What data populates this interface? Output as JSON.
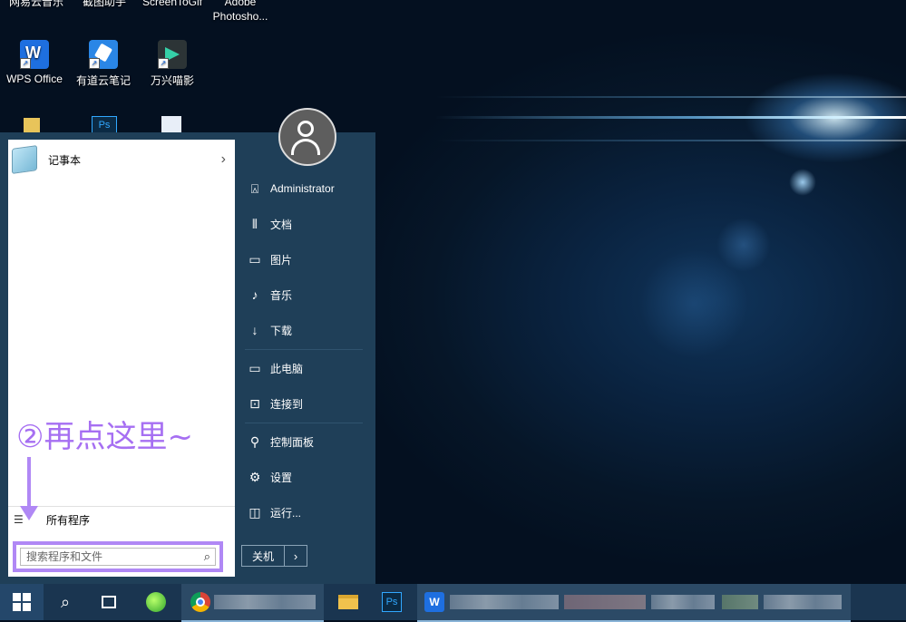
{
  "desktop": {
    "top_labels": [
      "网易云音乐",
      "截图助手",
      "ScreenToGif",
      "Adobe Photosho..."
    ],
    "icons": [
      {
        "label": "WPS Office",
        "icon": "wps-office-icon",
        "color": "#1e6fe0"
      },
      {
        "label": "有道云笔记",
        "icon": "youdao-note-icon",
        "color": "#2a86e6"
      },
      {
        "label": "万兴喵影",
        "icon": "filmora-icon",
        "color": "#2c3436"
      }
    ]
  },
  "start_menu": {
    "pinned": [
      {
        "label": "记事本",
        "icon": "notepad-icon"
      }
    ],
    "all_programs_label": "所有程序",
    "search_placeholder": "搜索程序和文件",
    "annotation": "②再点这里~",
    "right_items": [
      {
        "label": "Administrator",
        "icon": "user-folder-icon"
      },
      {
        "label": "文档",
        "icon": "documents-icon"
      },
      {
        "label": "图片",
        "icon": "pictures-icon"
      },
      {
        "label": "音乐",
        "icon": "music-icon"
      },
      {
        "label": "下载",
        "icon": "download-icon"
      },
      {
        "label": "此电脑",
        "icon": "computer-icon"
      },
      {
        "label": "连接到",
        "icon": "connect-icon"
      },
      {
        "label": "控制面板",
        "icon": "control-panel-icon"
      },
      {
        "label": "设置",
        "icon": "gear-icon"
      },
      {
        "label": "运行...",
        "icon": "run-icon"
      }
    ],
    "shutdown_label": "关机",
    "shutdown_arrow": "›"
  },
  "taskbar": {
    "items": [
      "start-button",
      "search-icon",
      "task-view-icon",
      "browser-360-icon",
      "chrome-icon",
      "file-explorer-icon",
      "photoshop-icon",
      "wps-icon"
    ]
  },
  "colors": {
    "accent": "#b088f5",
    "annotation": "#a66ff2",
    "start_bg": "#1f3f58",
    "taskbar_bg": "#1a3550"
  }
}
